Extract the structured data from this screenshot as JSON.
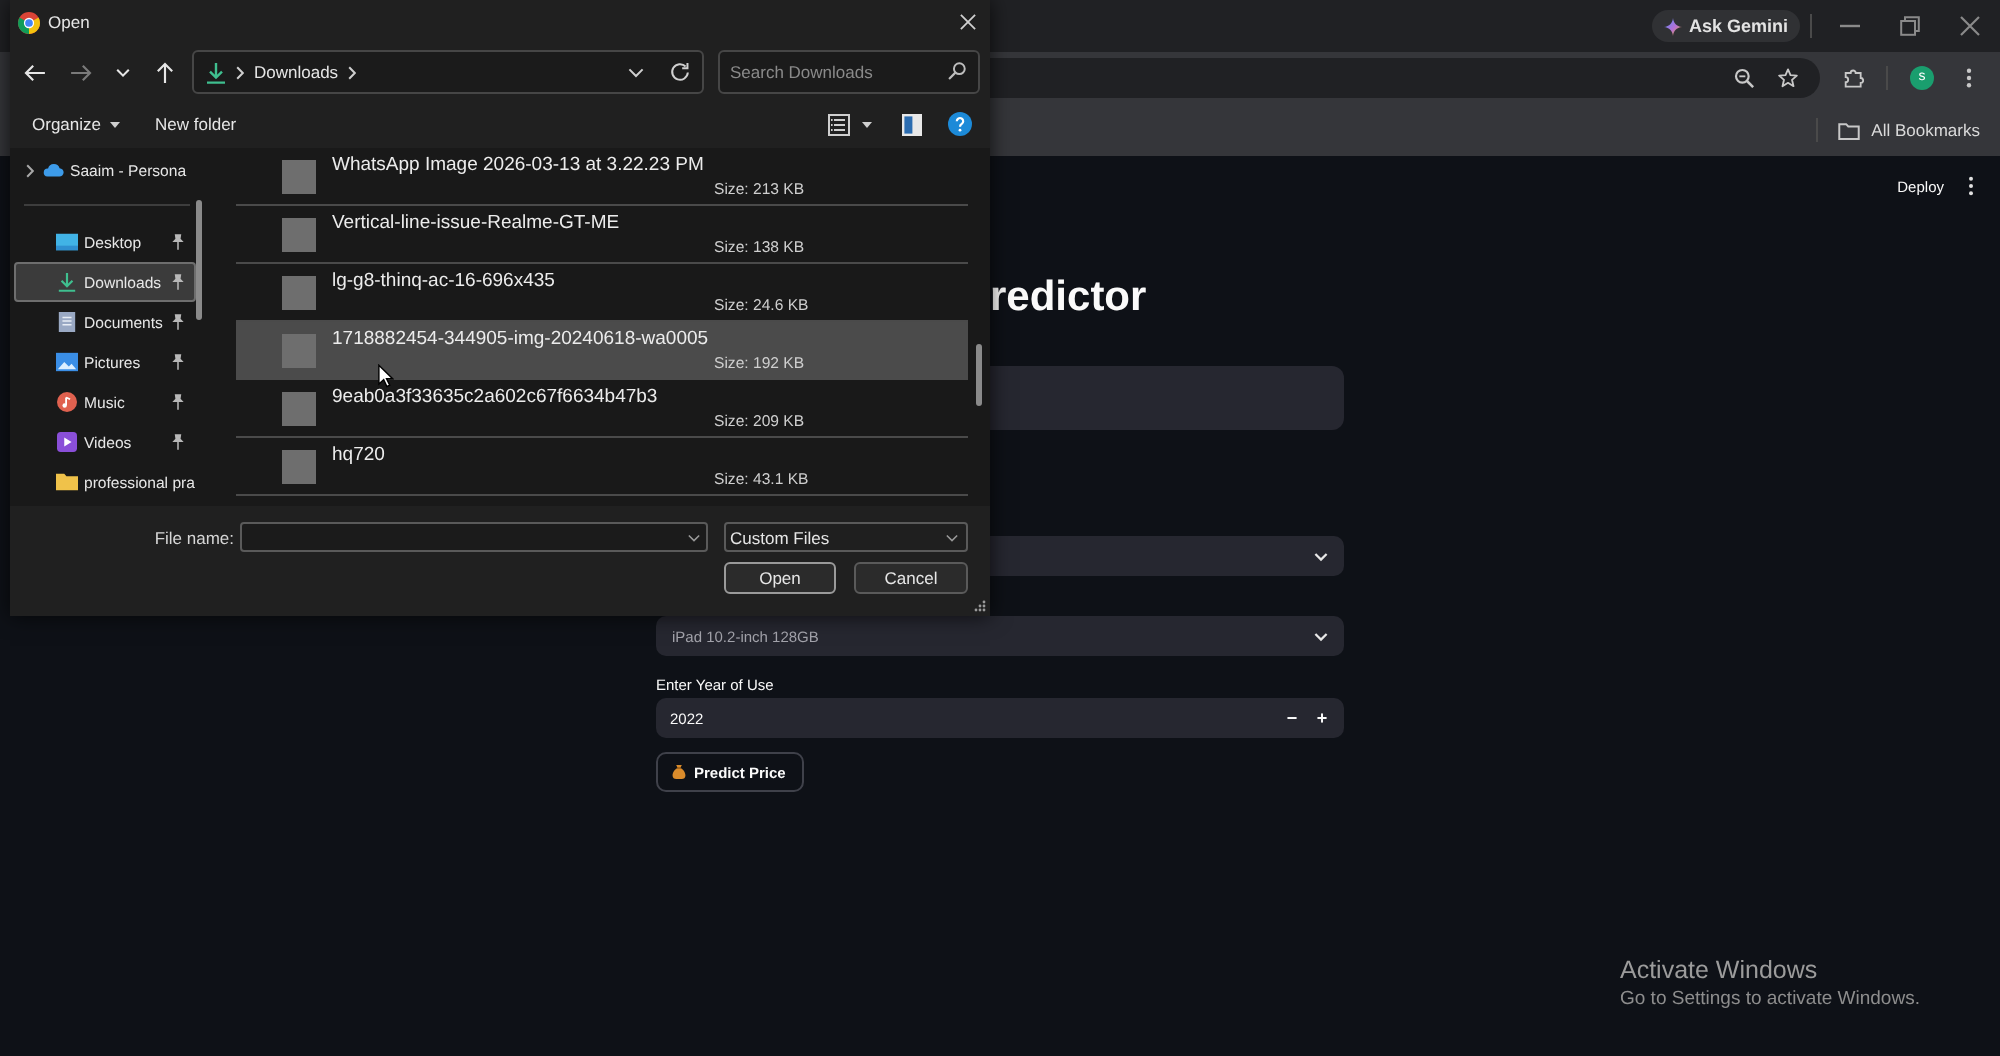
{
  "browser": {
    "gemini_button": "Ask Gemini",
    "avatar": "s",
    "bookmarks_folder": "All Bookmarks"
  },
  "dialog": {
    "title": "Open",
    "navigation": [
      {
        "kind": "back",
        "disabled": false
      },
      {
        "kind": "forward",
        "disabled": true
      },
      {
        "kind": "recent",
        "disabled": false
      },
      {
        "kind": "up",
        "disabled": false
      }
    ],
    "path": [
      "Downloads"
    ],
    "search": {
      "placeholder": "Search Downloads"
    },
    "commands": [
      {
        "label": "Organize",
        "kind": "menu"
      },
      {
        "label": "New folder",
        "kind": "button"
      }
    ],
    "nav_pane": [
      {
        "label": "Saaim - Persona",
        "kind": "cloud",
        "expandable": true,
        "pinned": false,
        "selected": false
      },
      {
        "label": "Desktop",
        "kind": "desktop",
        "expandable": false,
        "pinned": true,
        "selected": false
      },
      {
        "label": "Downloads",
        "kind": "downloads",
        "expandable": false,
        "pinned": true,
        "selected": true
      },
      {
        "label": "Documents",
        "kind": "documents",
        "expandable": false,
        "pinned": true,
        "selected": false
      },
      {
        "label": "Pictures",
        "kind": "pictures",
        "expandable": false,
        "pinned": true,
        "selected": false
      },
      {
        "label": "Music",
        "kind": "music",
        "expandable": false,
        "pinned": true,
        "selected": false
      },
      {
        "label": "Videos",
        "kind": "videos",
        "expandable": false,
        "pinned": true,
        "selected": false
      },
      {
        "label": "professional pra",
        "kind": "folder",
        "expandable": false,
        "pinned": false,
        "selected": false
      }
    ],
    "files": [
      {
        "name": "WhatsApp Image 2026-03-13 at 3.22.23 PM",
        "size": "Size: 213 KB",
        "selected": false
      },
      {
        "name": "Vertical-line-issue-Realme-GT-ME",
        "size": "Size: 138 KB",
        "selected": false
      },
      {
        "name": "lg-g8-thinq-ac-16-696x435",
        "size": "Size: 24.6 KB",
        "selected": false
      },
      {
        "name": "1718882454-344905-img-20240618-wa0005",
        "size": "Size: 192 KB",
        "selected": true
      },
      {
        "name": "9eab0a3f33635c2a602c67f6634b47b3",
        "size": "Size: 209 KB",
        "selected": false
      },
      {
        "name": "hq720",
        "size": "Size: 43.1 KB",
        "selected": false
      }
    ],
    "file_name": {
      "label": "File name:"
    },
    "file_type": {
      "value": "Custom Files"
    },
    "buttons": [
      {
        "label": "Open",
        "default": true
      },
      {
        "label": "Cancel",
        "default": false
      }
    ]
  },
  "page": {
    "deploy": "Deploy",
    "title": "redictor",
    "inputs": [
      {
        "kind": "text"
      },
      {
        "kind": "select"
      },
      {
        "kind": "select",
        "value": "iPad 10.2-inch 128GB"
      },
      {
        "kind": "number",
        "label": "Enter Year of Use",
        "value": "2022",
        "decrement": "−",
        "increment": "+"
      }
    ],
    "submit": "Predict Price"
  },
  "system_notice": {
    "title": "Activate Windows",
    "text": "Go to Settings to activate Windows."
  }
}
